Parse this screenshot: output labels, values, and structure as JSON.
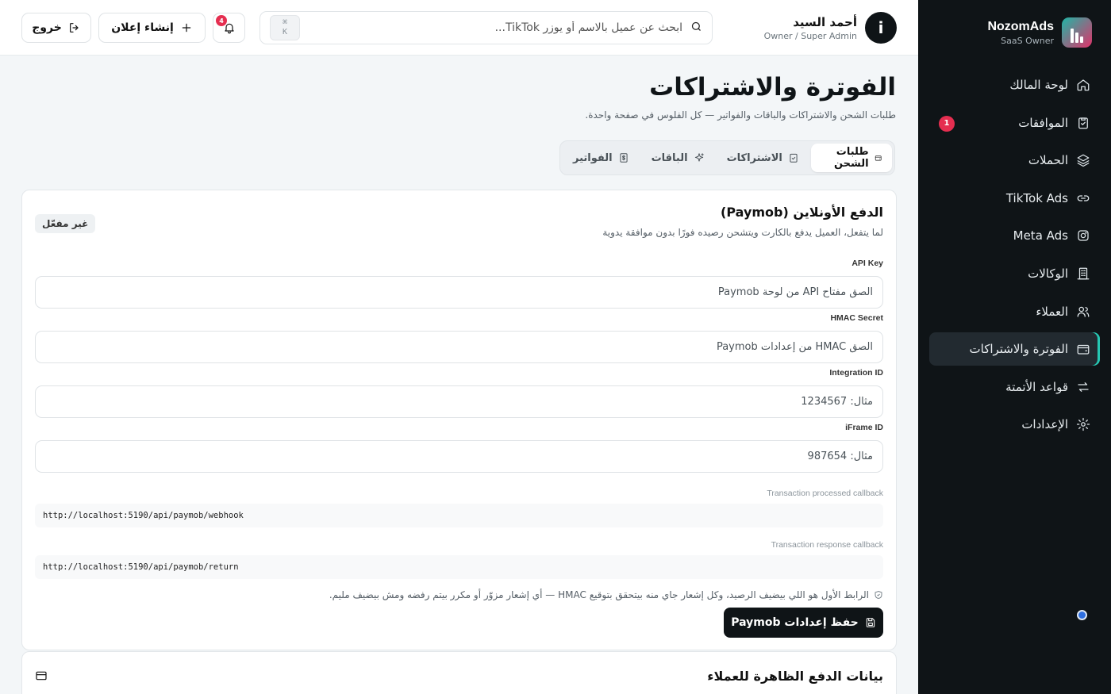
{
  "brand": {
    "name": "NozomAds",
    "subtitle": "SaaS Owner"
  },
  "sidebar": {
    "items": [
      {
        "label": "لوحة المالك",
        "icon": "home-icon"
      },
      {
        "label": "الموافقات",
        "icon": "clipboard-check-icon",
        "badge": "1"
      },
      {
        "label": "الحملات",
        "icon": "layers-icon"
      },
      {
        "label": "TikTok Ads",
        "icon": "link-icon"
      },
      {
        "label": "Meta Ads",
        "icon": "instagram-icon"
      },
      {
        "label": "الوكالات",
        "icon": "building-icon"
      },
      {
        "label": "العملاء",
        "icon": "users-icon"
      },
      {
        "label": "الفوترة والاشتراكات",
        "icon": "wallet-icon",
        "active": true
      },
      {
        "label": "قواعد الأتمتة",
        "icon": "repeat-icon"
      },
      {
        "label": "الإعدادات",
        "icon": "gear-icon"
      }
    ]
  },
  "header": {
    "user_name": "أحمد السيد",
    "user_role": "Owner / Super Admin",
    "avatar_letter": "i",
    "search_placeholder": "ابحث عن عميل بالاسم أو يوزر TikTok...",
    "shortcut_top": "⌘",
    "shortcut_bottom": "K",
    "notifications_count": "4",
    "create_ad_label": "إنشاء إعلان",
    "logout_label": "خروج"
  },
  "page": {
    "title": "الفوترة والاشتراكات",
    "subtitle": "طلبات الشحن والاشتراكات والباقات والفواتير — كل الفلوس في صفحة واحدة."
  },
  "tabs": [
    {
      "label": "طلبات الشحن",
      "active": true
    },
    {
      "label": "الاشتراكات"
    },
    {
      "label": "الباقات"
    },
    {
      "label": "الفواتير"
    }
  ],
  "paymob": {
    "title": "الدفع الأونلاين (Paymob)",
    "subtitle": "لما يتفعل، العميل يدفع بالكارت ويتشحن رصيده فورًا بدون موافقة يدوية",
    "status": "غير مفعّل",
    "fields": [
      {
        "label": "API Key",
        "placeholder": "الصق مفتاح API من لوحة Paymob"
      },
      {
        "label": "HMAC Secret",
        "placeholder": "الصق HMAC من إعدادات Paymob"
      },
      {
        "label": "Integration ID",
        "placeholder": "مثال: 1234567"
      },
      {
        "label": "iFrame ID",
        "placeholder": "مثال: 987654"
      }
    ],
    "callbacks": [
      {
        "label": "Transaction processed callback",
        "value": "http://localhost:5190/api/paymob/webhook"
      },
      {
        "label": "Transaction response callback",
        "value": "http://localhost:5190/api/paymob/return"
      }
    ],
    "note": "الرابط الأول هو اللي بيضيف الرصيد، وكل إشعار جاي منه بيتحقق بتوقيع HMAC — أي إشعار مزوّر أو مكرر بيتم رفضه ومش بيضيف مليم.",
    "save_label": "حفظ إعدادات Paymob"
  },
  "payment_info": {
    "title": "بيانات الدفع الظاهرة للعملاء"
  },
  "colors": {
    "sidebar_bg": "#0f1417",
    "accent": "#26c6b2",
    "badge": "#e52e50",
    "dark_button": "#0f1417"
  }
}
